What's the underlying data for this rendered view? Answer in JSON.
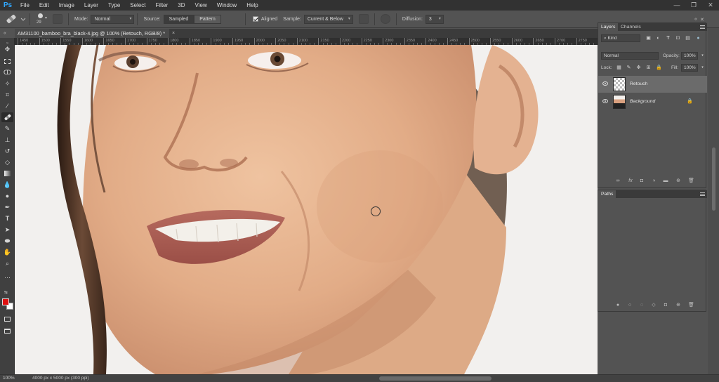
{
  "app": {
    "logo": "Ps"
  },
  "menu": [
    "File",
    "Edit",
    "Image",
    "Layer",
    "Type",
    "Select",
    "Filter",
    "3D",
    "View",
    "Window",
    "Help"
  ],
  "options": {
    "brush_size": "29",
    "mode_label": "Mode:",
    "mode_value": "Normal",
    "source_label": "Source:",
    "source_sampled": "Sampled",
    "source_pattern": "Pattern",
    "aligned_label": "Aligned",
    "sample_label": "Sample:",
    "sample_value": "Current & Below",
    "diffusion_label": "Diffusion:",
    "diffusion_value": "3"
  },
  "document": {
    "tab_title": "AM31100_bamboo_bra_black-4.jpg @ 100% (Retouch, RGB/8) *",
    "close": "×"
  },
  "ruler_top": [
    "1450",
    "1500",
    "1550",
    "1600",
    "1650",
    "1700",
    "1750",
    "1800",
    "1850",
    "1900",
    "1950",
    "2000",
    "2050",
    "2100",
    "2150",
    "2200",
    "2250",
    "2300",
    "2350",
    "2400",
    "2450",
    "2500",
    "2550",
    "2600",
    "2650",
    "2700",
    "2750"
  ],
  "status": {
    "zoom": "100%",
    "doc_info": "4000 px x 5000 px (300 ppi)"
  },
  "layers_panel": {
    "tabs": [
      "Layers",
      "Channels"
    ],
    "kind_value": "Kind",
    "blend_value": "Normal",
    "opacity_label": "Opacity:",
    "opacity_value": "100%",
    "lock_label": "Lock:",
    "fill_label": "Fill:",
    "fill_value": "100%",
    "layers": [
      {
        "name": "Retouch",
        "visible": true,
        "selected": true
      },
      {
        "name": "Background",
        "visible": true,
        "selected": false,
        "locked": true
      }
    ],
    "footer_icons": [
      "link-icon",
      "fx-icon",
      "mask-icon",
      "adjustment-icon",
      "group-icon",
      "new-layer-icon",
      "trash-icon"
    ]
  },
  "paths_panel": {
    "tab": "Paths",
    "footer_icons": [
      "fill-path-icon",
      "stroke-path-icon",
      "load-selection-icon",
      "make-path-icon",
      "add-mask-icon",
      "new-path-icon",
      "trash-icon"
    ]
  },
  "colors": {
    "foreground": "#e01010",
    "background": "#ffffff",
    "accent": "#31a8ff"
  }
}
